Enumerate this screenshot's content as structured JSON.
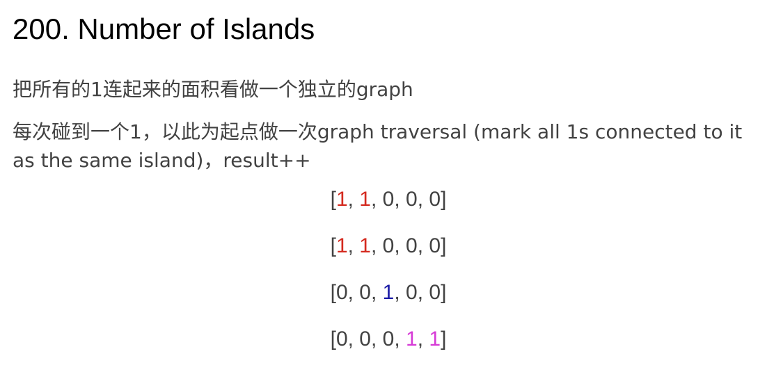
{
  "title": "200. Number of Islands",
  "paragraphs": [
    "把所有的1连起来的面积看做一个独立的graph",
    "每次碰到一个1，以此为起点做一次graph traversal (mark all 1s connected to it as the same island)，result++"
  ],
  "grid": [
    [
      {
        "v": "1",
        "color": "#d42a1f"
      },
      {
        "v": "1",
        "color": "#d42a1f"
      },
      {
        "v": "0",
        "color": "#424242"
      },
      {
        "v": "0",
        "color": "#424242"
      },
      {
        "v": "0",
        "color": "#424242"
      }
    ],
    [
      {
        "v": "1",
        "color": "#d42a1f"
      },
      {
        "v": "1",
        "color": "#d42a1f"
      },
      {
        "v": "0",
        "color": "#424242"
      },
      {
        "v": "0",
        "color": "#424242"
      },
      {
        "v": "0",
        "color": "#424242"
      }
    ],
    [
      {
        "v": "0",
        "color": "#424242"
      },
      {
        "v": "0",
        "color": "#424242"
      },
      {
        "v": "1",
        "color": "#1a1aa6"
      },
      {
        "v": "0",
        "color": "#424242"
      },
      {
        "v": "0",
        "color": "#424242"
      }
    ],
    [
      {
        "v": "0",
        "color": "#424242"
      },
      {
        "v": "0",
        "color": "#424242"
      },
      {
        "v": "0",
        "color": "#424242"
      },
      {
        "v": "1",
        "color": "#d63ad6"
      },
      {
        "v": "1",
        "color": "#d63ad6"
      }
    ]
  ]
}
